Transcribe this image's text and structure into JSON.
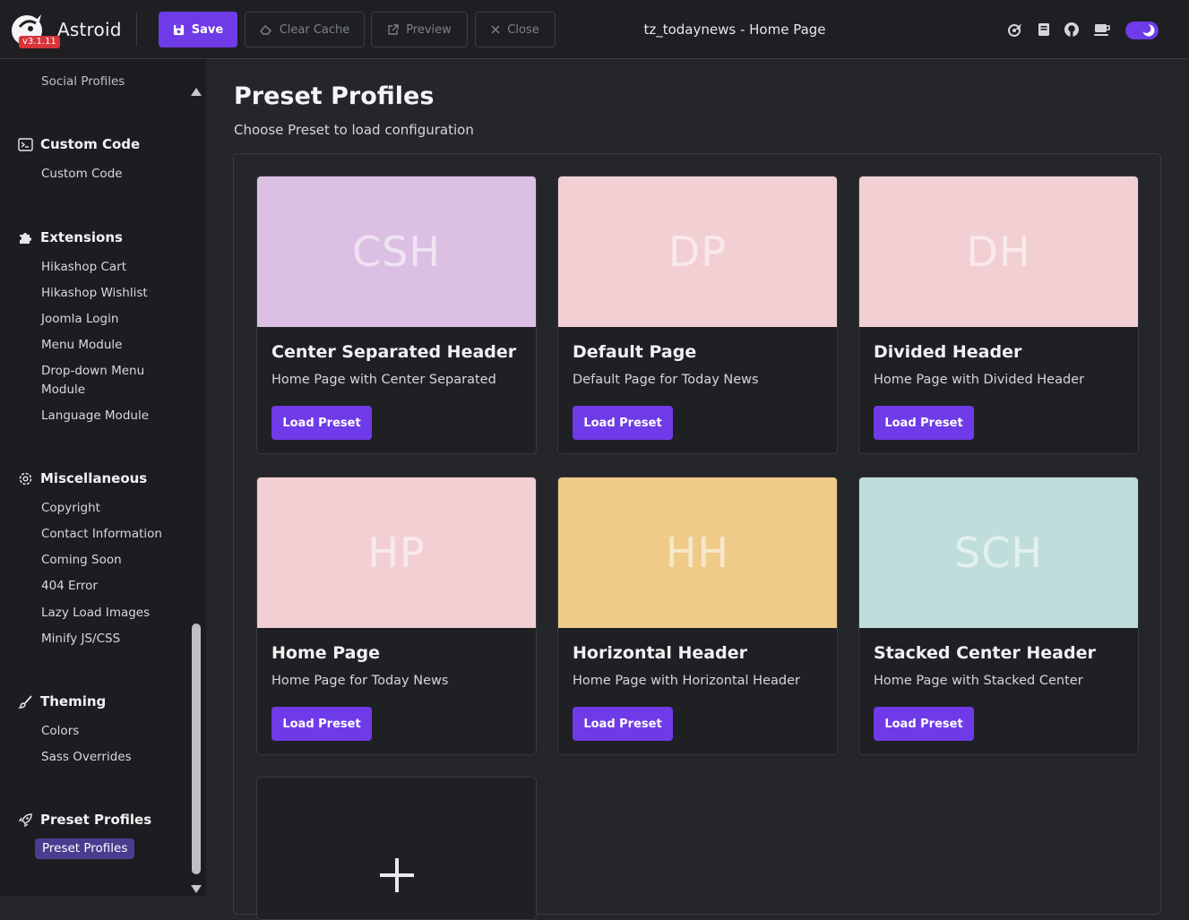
{
  "app": {
    "name": "Astroid",
    "version": "v3.1.11",
    "page_title": "tz_todaynews - Home Page"
  },
  "toolbar": {
    "save_label": "Save",
    "clear_cache_label": "Clear Cache",
    "preview_label": "Preview",
    "close_label": "Close",
    "icons": [
      "astroid-icon",
      "book-icon",
      "github-icon",
      "coffee-icon"
    ],
    "dark_mode_enabled": true
  },
  "sidebar": {
    "top_cut_item": "Social Profiles",
    "sections": [
      {
        "title": "Custom Code",
        "icon": "code-icon",
        "items": [
          "Custom Code"
        ]
      },
      {
        "title": "Extensions",
        "icon": "puzzle-icon",
        "items": [
          "Hikashop Cart",
          "Hikashop Wishlist",
          "Joomla Login",
          "Menu Module",
          "Drop-down Menu Module",
          "Language Module"
        ]
      },
      {
        "title": "Miscellaneous",
        "icon": "gear-icon",
        "items": [
          "Copyright",
          "Contact Information",
          "Coming Soon",
          "404 Error",
          "Lazy Load Images",
          "Minify JS/CSS"
        ]
      },
      {
        "title": "Theming",
        "icon": "brush-icon",
        "items": [
          "Colors",
          "Sass Overrides"
        ]
      },
      {
        "title": "Preset Profiles",
        "icon": "rocket-icon",
        "items": [
          "Preset Profiles"
        ]
      }
    ],
    "active_item": "Preset Profiles"
  },
  "main": {
    "title": "Preset Profiles",
    "subtitle": "Choose Preset to load configuration",
    "load_button_label": "Load Preset",
    "presets": [
      {
        "abbr": "CSH",
        "title": "Center Separated Header",
        "description": "Home Page with Center Separated",
        "color": "#dbc0e4"
      },
      {
        "abbr": "DP",
        "title": "Default Page",
        "description": "Default Page for Today News",
        "color": "#f2cfd3"
      },
      {
        "abbr": "DH",
        "title": "Divided Header",
        "description": "Home Page with Divided Header",
        "color": "#f2cfd3"
      },
      {
        "abbr": "HP",
        "title": "Home Page",
        "description": "Home Page for Today News",
        "color": "#f2cfd3"
      },
      {
        "abbr": "HH",
        "title": "Horizontal Header",
        "description": "Home Page with Horizontal Header",
        "color": "#efcb8a"
      },
      {
        "abbr": "SCH",
        "title": "Stacked Center Header",
        "description": "Home Page with Stacked Center",
        "color": "#bfdedb"
      }
    ]
  },
  "colors": {
    "accent": "#6f3be8",
    "background": "#24262a",
    "sidebar": "#1c1d20",
    "active_item": "#4a3c8f"
  }
}
